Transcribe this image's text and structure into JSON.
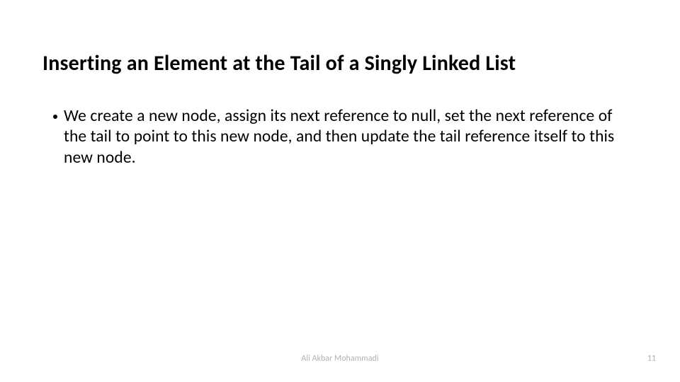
{
  "title": "Inserting an Element at the Tail of a Singly Linked List",
  "body": {
    "bullets": [
      "We create a new node, assign its next reference to null, set the next reference of the tail to point to this new node, and then update the tail reference itself to this new node."
    ]
  },
  "footer": {
    "author": "Ali Akbar Mohammadi",
    "page_number": "11"
  }
}
